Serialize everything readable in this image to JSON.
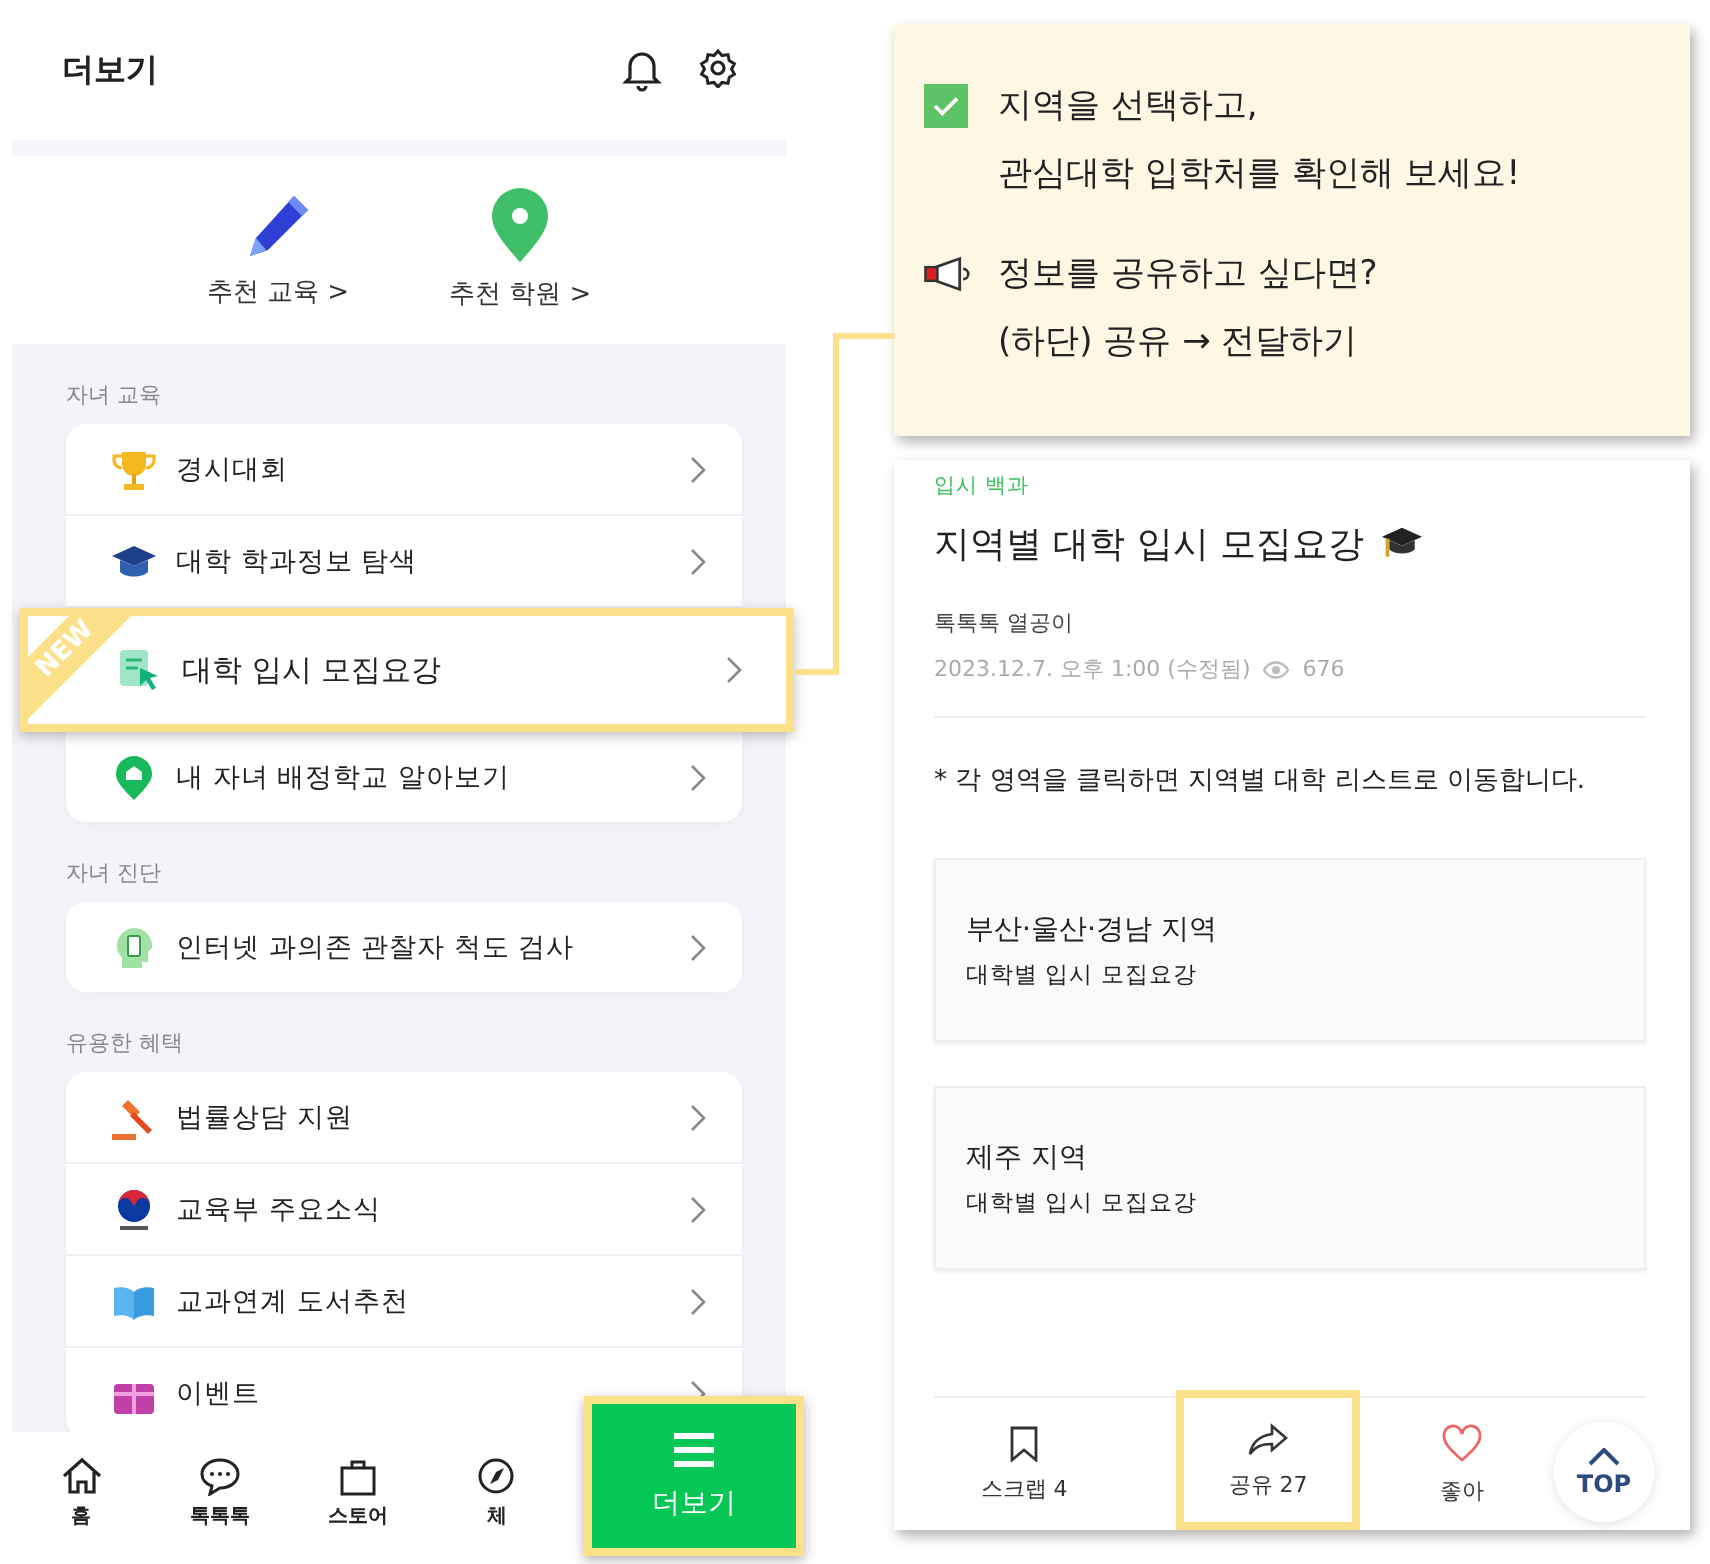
{
  "more_screen": {
    "title": "더보기",
    "shortcuts": [
      {
        "label": "추천 교육 >",
        "kind": "pencil"
      },
      {
        "label": "추천 학원 >",
        "kind": "pin"
      }
    ],
    "sections": [
      {
        "heading": "자녀 교육",
        "items": [
          {
            "label": "경시대회",
            "kind": "trophy",
            "highlighted": false
          },
          {
            "label": "대학 학과정보 탐색",
            "kind": "cap",
            "highlighted": false
          },
          {
            "label": "대학 입시 모집요강",
            "kind": "doc",
            "highlighted": true,
            "badge": "NEW"
          },
          {
            "label": "내 자녀 배정학교 알아보기",
            "kind": "school",
            "highlighted": false
          }
        ]
      },
      {
        "heading": "자녀 진단",
        "items": [
          {
            "label": "인터넷 과의존 관찰자 척도 검사",
            "kind": "phone",
            "highlighted": false
          }
        ]
      },
      {
        "heading": "유용한 혜택",
        "items": [
          {
            "label": "법률상담 지원",
            "kind": "gavel",
            "highlighted": false
          },
          {
            "label": "교육부 주요소식",
            "kind": "emblem",
            "highlighted": false
          },
          {
            "label": "교과연계 도서추천",
            "kind": "book",
            "highlighted": false
          },
          {
            "label": "이벤트",
            "kind": "gift",
            "highlighted": false
          }
        ]
      }
    ],
    "nav": [
      {
        "label": "홈",
        "kind": "home"
      },
      {
        "label": "톡톡톡",
        "kind": "chat"
      },
      {
        "label": "스토어",
        "kind": "bag"
      },
      {
        "label": "체",
        "kind": "compass"
      }
    ],
    "more_button": {
      "label": "더보기",
      "highlighted": true
    }
  },
  "callout": [
    {
      "kind": "check",
      "lines": [
        "지역을 선택하고,",
        "관심대학 입학처를  확인해 보세요!"
      ]
    },
    {
      "kind": "megaphone",
      "lines": [
        "정보를 공유하고 싶다면?",
        "(하단) 공유 → 전달하기"
      ]
    }
  ],
  "article": {
    "category": "입시 백과",
    "title": "지역별 대학 입시 모집요강",
    "author": "톡톡톡 열공이",
    "date": "2023.12.7. 오후 1:00 (수정됨)",
    "views": "676",
    "notice": "* 각 영역을 클릭하면 지역별 대학 리스트로 이동합니다.",
    "regions": [
      {
        "title": "부산·울산·경남 지역",
        "subtitle": "대학별 입시 모집요강"
      },
      {
        "title": "제주 지역",
        "subtitle": "대학별 입시 모집요강"
      }
    ],
    "actions": [
      {
        "label": "스크랩 4",
        "kind": "bookmark",
        "highlighted": false
      },
      {
        "label": "공유 27",
        "kind": "share",
        "highlighted": true
      },
      {
        "label": "좋아",
        "kind": "heart",
        "highlighted": false
      }
    ],
    "top_button": "TOP"
  }
}
